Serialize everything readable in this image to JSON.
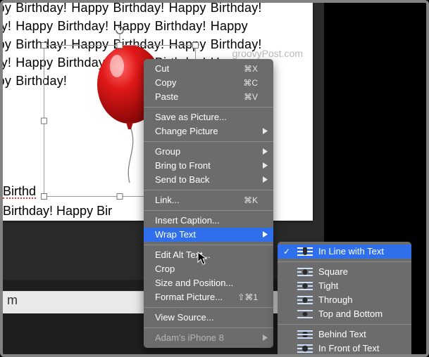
{
  "document": {
    "repeated_text": "Birthday! Happy Birthday! Happy Birthday! Happy Birthday! Happy Birthday! Happy Birthday! Happy Birthday! Happy Birthday! Happy Birthday! Happy Birthday! Happy Birthday! Happy Birthday! Happy Birthday! Happy Birthday! Happy Birthday! Happy Birthday!",
    "error_word": "Birthd",
    "below_line": "y Birthday! Happy Bir",
    "watermark": "groovyPost.com",
    "ruler_char": "m"
  },
  "context_menu": {
    "cut": {
      "label": "Cut",
      "shortcut": "⌘X"
    },
    "copy": {
      "label": "Copy",
      "shortcut": "⌘C"
    },
    "paste": {
      "label": "Paste",
      "shortcut": "⌘V"
    },
    "save_as_picture": {
      "label": "Save as Picture..."
    },
    "change_picture": {
      "label": "Change Picture"
    },
    "group": {
      "label": "Group"
    },
    "bring_to_front": {
      "label": "Bring to Front"
    },
    "send_to_back": {
      "label": "Send to Back"
    },
    "link": {
      "label": "Link...",
      "shortcut": "⌘K"
    },
    "insert_caption": {
      "label": "Insert Caption..."
    },
    "wrap_text": {
      "label": "Wrap Text"
    },
    "edit_alt_text": {
      "label": "Edit Alt Text..."
    },
    "crop": {
      "label": "Crop"
    },
    "size_and_position": {
      "label": "Size and Position..."
    },
    "format_picture": {
      "label": "Format Picture...",
      "shortcut": "⇧⌘1"
    },
    "view_source": {
      "label": "View Source..."
    },
    "adams_iphone": {
      "label": "Adam's iPhone 8"
    }
  },
  "wrap_submenu": {
    "in_line": {
      "label": "In Line with Text"
    },
    "square": {
      "label": "Square"
    },
    "tight": {
      "label": "Tight"
    },
    "through": {
      "label": "Through"
    },
    "top_bottom": {
      "label": "Top and Bottom"
    },
    "behind": {
      "label": "Behind Text"
    },
    "in_front": {
      "label": "In Front of Text"
    }
  }
}
